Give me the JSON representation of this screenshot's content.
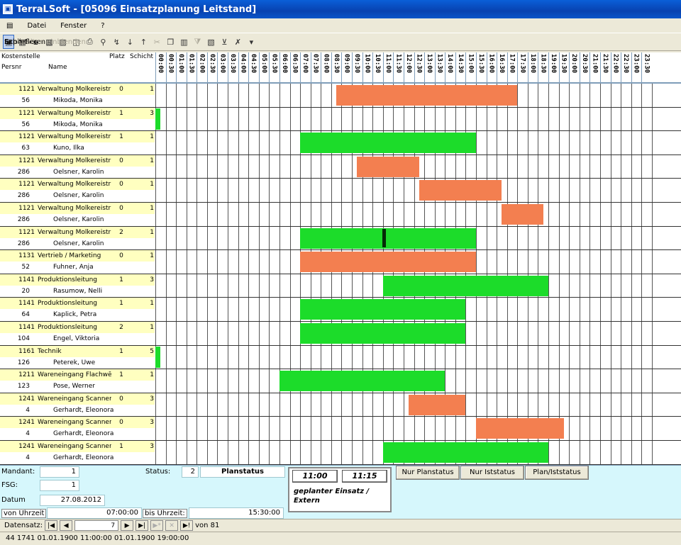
{
  "window": {
    "title": "TerraLSoft - [05096 Einsatzplanung Leitstand]"
  },
  "menu": {
    "items": [
      "Datei",
      "Fenster",
      "?"
    ]
  },
  "toolbar": {
    "close": "Schließen",
    "export": "Exportieren",
    "columns": "Spalten einblenden"
  },
  "columns": {
    "kostenstelle": "Kostenstelle",
    "platz": "Platz",
    "schicht": "Schicht",
    "persnr": "Persnr",
    "name": "Name"
  },
  "times": [
    "00:00",
    "00:30",
    "01:00",
    "01:30",
    "02:00",
    "02:30",
    "03:00",
    "03:30",
    "04:00",
    "04:30",
    "05:00",
    "05:30",
    "06:00",
    "06:30",
    "07:00",
    "07:30",
    "08:00",
    "08:30",
    "09:00",
    "09:30",
    "10:00",
    "10:30",
    "11:00",
    "11:30",
    "12:00",
    "12:30",
    "13:00",
    "13:30",
    "14:00",
    "14:30",
    "15:00",
    "15:30",
    "16:00",
    "16:30",
    "17:00",
    "17:30",
    "18:00",
    "18:30",
    "19:00",
    "19:30",
    "20:00",
    "20:30",
    "21:00",
    "21:30",
    "22:00",
    "22:30",
    "23:00",
    "23:30"
  ],
  "colors": {
    "plan": "#f37f50",
    "ist": "#1cdc2a",
    "info": "#ffffc0",
    "panel": "#d6f7fc"
  },
  "rows": [
    {
      "ks": "1121",
      "ks_name": "Verwaltung Molkereistr",
      "platz": "0",
      "schicht": "1",
      "persnr": "56",
      "name": "Mikoda, Monika",
      "bars": [
        {
          "type": "plan",
          "start": "08:45",
          "end": "17:30"
        }
      ]
    },
    {
      "ks": "1121",
      "ks_name": "Verwaltung Molkereistr",
      "platz": "1",
      "schicht": "3",
      "persnr": "56",
      "name": "Mikoda, Monika",
      "bars": [],
      "mark": true
    },
    {
      "ks": "1121",
      "ks_name": "Verwaltung Molkereistr",
      "platz": "1",
      "schicht": "1",
      "persnr": "63",
      "name": "Kuno, Ilka",
      "bars": [
        {
          "type": "ist",
          "start": "07:00",
          "end": "15:30"
        }
      ]
    },
    {
      "ks": "1121",
      "ks_name": "Verwaltung Molkereistr",
      "platz": "0",
      "schicht": "1",
      "persnr": "286",
      "name": "Oelsner, Karolin",
      "bars": [
        {
          "type": "plan",
          "start": "09:45",
          "end": "12:45"
        }
      ]
    },
    {
      "ks": "1121",
      "ks_name": "Verwaltung Molkereistr",
      "platz": "0",
      "schicht": "1",
      "persnr": "286",
      "name": "Oelsner, Karolin",
      "bars": [
        {
          "type": "plan",
          "start": "12:45",
          "end": "16:45"
        }
      ]
    },
    {
      "ks": "1121",
      "ks_name": "Verwaltung Molkereistr",
      "platz": "0",
      "schicht": "1",
      "persnr": "286",
      "name": "Oelsner, Karolin",
      "bars": [
        {
          "type": "plan",
          "start": "16:45",
          "end": "18:45"
        }
      ]
    },
    {
      "ks": "1121",
      "ks_name": "Verwaltung Molkereistr",
      "platz": "2",
      "schicht": "1",
      "persnr": "286",
      "name": "Oelsner, Karolin",
      "bars": [
        {
          "type": "ist",
          "start": "07:00",
          "end": "15:30"
        }
      ],
      "cursor": "11:00"
    },
    {
      "ks": "1131",
      "ks_name": "Vertrieb / Marketing",
      "platz": "0",
      "schicht": "1",
      "persnr": "52",
      "name": "Fuhner, Anja",
      "bars": [
        {
          "type": "plan",
          "start": "07:00",
          "end": "15:30"
        }
      ]
    },
    {
      "ks": "1141",
      "ks_name": "Produktionsleitung",
      "platz": "1",
      "schicht": "3",
      "persnr": "20",
      "name": "Rasumow, Nelli",
      "bars": [
        {
          "type": "ist",
          "start": "11:00",
          "end": "19:00"
        }
      ]
    },
    {
      "ks": "1141",
      "ks_name": "Produktionsleitung",
      "platz": "1",
      "schicht": "1",
      "persnr": "64",
      "name": "Kaplick, Petra",
      "bars": [
        {
          "type": "ist",
          "start": "07:00",
          "end": "15:00"
        }
      ]
    },
    {
      "ks": "1141",
      "ks_name": "Produktionsleitung",
      "platz": "2",
      "schicht": "1",
      "persnr": "104",
      "name": "Engel, Viktoria",
      "bars": [
        {
          "type": "ist",
          "start": "07:00",
          "end": "15:00"
        }
      ]
    },
    {
      "ks": "1161",
      "ks_name": "Technik",
      "platz": "1",
      "schicht": "5",
      "persnr": "126",
      "name": "Peterek, Uwe",
      "bars": [],
      "mark": true
    },
    {
      "ks": "1211",
      "ks_name": "Wareneingang Flachwē",
      "platz": "1",
      "schicht": "1",
      "persnr": "123",
      "name": "Pose, Werner",
      "bars": [
        {
          "type": "ist",
          "start": "06:00",
          "end": "14:00"
        }
      ]
    },
    {
      "ks": "1241",
      "ks_name": "Wareneingang Scanner",
      "platz": "0",
      "schicht": "3",
      "persnr": "4",
      "name": "Gerhardt, Eleonora",
      "bars": [
        {
          "type": "plan",
          "start": "12:15",
          "end": "15:00"
        }
      ]
    },
    {
      "ks": "1241",
      "ks_name": "Wareneingang Scanner",
      "platz": "0",
      "schicht": "3",
      "persnr": "4",
      "name": "Gerhardt, Eleonora",
      "bars": [
        {
          "type": "plan",
          "start": "15:30",
          "end": "19:45"
        }
      ]
    },
    {
      "ks": "1241",
      "ks_name": "Wareneingang Scanner",
      "platz": "1",
      "schicht": "3",
      "persnr": "4",
      "name": "Gerhardt, Eleonora",
      "bars": [
        {
          "type": "ist",
          "start": "11:00",
          "end": "19:00"
        }
      ]
    }
  ],
  "bottom": {
    "mandant_label": "Mandant:",
    "mandant": "1",
    "fsg_label": "FSG:",
    "fsg": "1",
    "datum_label": "Datum",
    "datum": "27.08.2012",
    "von_label": "von Uhrzeit",
    "von": "07:00:00",
    "bis_label": "bis Uhrzeit:",
    "bis": "15:30:00",
    "status_label": "Status:",
    "status": "2",
    "status_text": "Planstatus",
    "t_from": "11:00",
    "t_to": "11:15",
    "einsatz": "geplanter Einsatz / Extern",
    "btn_plan": "Nur Planstatus",
    "btn_ist": "Nur Iststatus",
    "btn_both": "Plan/Iststatus"
  },
  "nav": {
    "label": "Datensatz:",
    "current": "7",
    "of": "von 81"
  },
  "status": {
    "text": "44 1741 01.01.1900 11:00:00 01.01.1900 19:00:00"
  }
}
